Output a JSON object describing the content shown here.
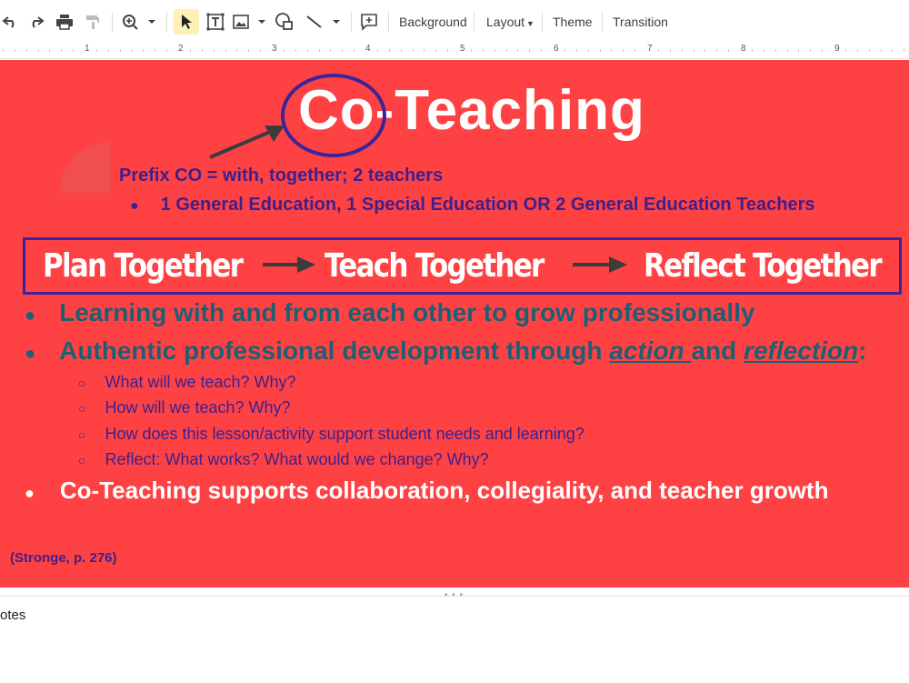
{
  "toolbar": {
    "background_label": "Background",
    "layout_label": "Layout",
    "theme_label": "Theme",
    "transition_label": "Transition",
    "icons": [
      "undo-icon",
      "redo-icon",
      "print-icon",
      "paint-format-icon",
      "zoom-icon",
      "select-icon",
      "text-box-icon",
      "image-icon",
      "shape-icon",
      "line-icon",
      "comment-icon"
    ]
  },
  "ruler": {
    "numbers": [
      "1",
      "2",
      "3",
      "4",
      "5",
      "6",
      "7",
      "8",
      "9"
    ]
  },
  "slide": {
    "title": "Co-Teaching",
    "prefix_line": "Prefix CO = with, together; 2 teachers",
    "bullet_general": "1 General Education, 1 Special Education OR 2 General Education Teachers",
    "plan": "Plan Together",
    "teach": "Teach Together",
    "reflect": "Reflect Together",
    "bullet_learning": "Learning with and from each other to grow professionally",
    "bullet_authentic_pre": "Authentic professional development through ",
    "bullet_authentic_action": "action ",
    "bullet_authentic_mid": "and ",
    "bullet_authentic_reflection": "reflection",
    "bullet_authentic_post": ":",
    "q1": "What will we teach? Why?",
    "q2": "How will we teach? Why?",
    "q3": "How does this lesson/activity support student needs and learning?",
    "q4": "Reflect: What works? What would we change? Why?",
    "bullet_supports": "Co-Teaching supports collaboration, collegiality, and teacher growth",
    "citation": "(Stronge, p. 276)"
  },
  "notes": {
    "label": "otes"
  },
  "colors": {
    "slide_bg": "#fe4244",
    "purple": "#3e1f8d",
    "teal": "#1e5f74",
    "white": "#ffffff"
  }
}
